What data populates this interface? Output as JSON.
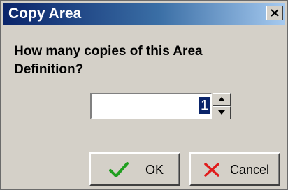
{
  "dialog": {
    "title": "Copy Area",
    "question": "How many copies of this Area Definition?",
    "copies_value": "1",
    "ok_label": "OK",
    "cancel_label": "Cancel"
  },
  "colors": {
    "titlebar_start": "#0a246a",
    "titlebar_end": "#a6caf0",
    "face": "#d4d0c8",
    "ok_check": "#1f9f1f",
    "cancel_x": "#e01c1c"
  },
  "icons": {
    "close": "close-icon",
    "spin_up": "arrow-up-icon",
    "spin_down": "arrow-down-icon",
    "ok": "check-icon",
    "cancel": "x-icon"
  }
}
